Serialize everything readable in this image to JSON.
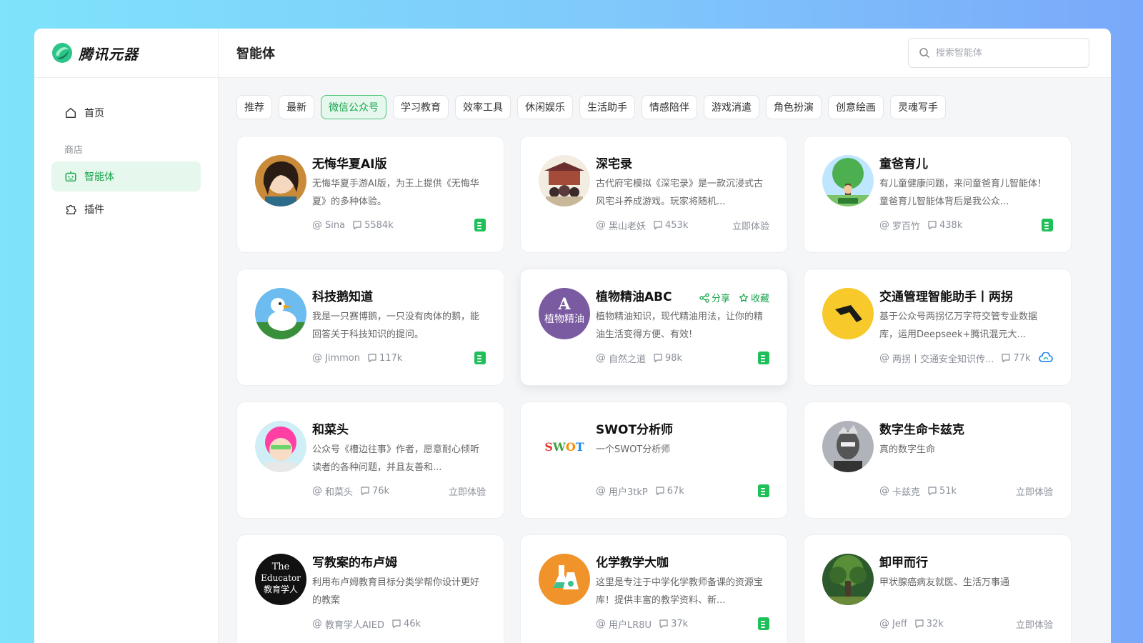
{
  "brand": {
    "name": "腾讯元器",
    "logo_icon": "yuanqi-logo-icon",
    "accent": "#16a34a"
  },
  "sidebar": {
    "home_label": "首页",
    "section_label": "商店",
    "items": [
      {
        "label": "智能体",
        "icon": "robot-icon",
        "active": true
      },
      {
        "label": "插件",
        "icon": "puzzle-icon",
        "active": false
      }
    ]
  },
  "header": {
    "title": "智能体"
  },
  "search": {
    "placeholder": "搜索智能体",
    "value": ""
  },
  "tabs": [
    {
      "label": "推荐"
    },
    {
      "label": "最新"
    },
    {
      "label": "微信公众号",
      "active": true
    },
    {
      "label": "学习教育"
    },
    {
      "label": "效率工具"
    },
    {
      "label": "休闲娱乐"
    },
    {
      "label": "生活助手"
    },
    {
      "label": "情感陪伴"
    },
    {
      "label": "游戏消遣"
    },
    {
      "label": "角色扮演"
    },
    {
      "label": "创意绘画"
    },
    {
      "label": "灵魂写手"
    }
  ],
  "card_actions": {
    "share": "分享",
    "favorite": "收藏"
  },
  "cards": [
    {
      "title": "无悔华夏AI版",
      "desc": "无悔华夏手游AI版，为王上提供《无悔华夏》的多种体验。",
      "author": "Sina",
      "count": "5584k",
      "badge": "wechat"
    },
    {
      "title": "深宅录",
      "desc": "古代府宅模拟《深宅录》是一款沉浸式古风宅斗养成游戏。玩家将随机...",
      "author": "黑山老妖",
      "count": "453k",
      "badge": "try",
      "try_label": "立即体验"
    },
    {
      "title": "童爸育儿",
      "desc": "有儿童健康问题，来问童爸育儿智能体！童爸育儿智能体背后是我公众...",
      "author": "罗百竹",
      "count": "438k",
      "badge": "wechat"
    },
    {
      "title": "科技鹅知道",
      "desc": "我是一只赛博鹅，一只没有肉体的鹅，能回答关于科技知识的提问。",
      "author": "Jimmon",
      "count": "117k",
      "badge": "wechat"
    },
    {
      "title": "植物精油ABC",
      "desc": "植物精油知识，现代精油用法，让你的精油生活变得方便、有效!",
      "author": "自然之道",
      "count": "98k",
      "badge": "wechat",
      "hover": true,
      "avatar_text": "植物精油"
    },
    {
      "title": "交通管理智能助手丨两拐",
      "desc": "基于公众号两拐亿万字符交管专业数据库，运用Deepseek+腾讯混元大...",
      "author": "两拐丨交通安全知识传...",
      "count": "77k",
      "badge": "cloud"
    },
    {
      "title": "和菜头",
      "desc": "公众号《槽边往事》作者，愿意耐心倾听读者的各种问题，并且友善和...",
      "author": "和菜头",
      "count": "76k",
      "badge": "try",
      "try_label": "立即体验"
    },
    {
      "title": "SWOT分析师",
      "desc": "一个SWOT分析师",
      "author": "用户3tkP",
      "count": "67k",
      "badge": "wechat",
      "avatar_text": "SWOT"
    },
    {
      "title": "数字生命卡兹克",
      "desc": "真的数字生命",
      "author": "卡兹克",
      "count": "51k",
      "badge": "try",
      "try_label": "立即体验"
    },
    {
      "title": "写教案的布卢姆",
      "desc": "利用布卢姆教育目标分类学帮你设计更好的教案",
      "author": "教育学人AIED",
      "count": "46k",
      "badge": "none",
      "avatar_text": "The Educator 教育学人"
    },
    {
      "title": "化学教学大咖",
      "desc": "这里是专注于中学化学教师备课的资源宝库！提供丰富的教学资料、新...",
      "author": "用户LR8U",
      "count": "37k",
      "badge": "wechat"
    },
    {
      "title": "卸甲而行",
      "desc": "甲状腺癌病友就医、生活万事通",
      "author": "Jeff",
      "count": "32k",
      "badge": "try",
      "try_label": "立即体验"
    }
  ]
}
